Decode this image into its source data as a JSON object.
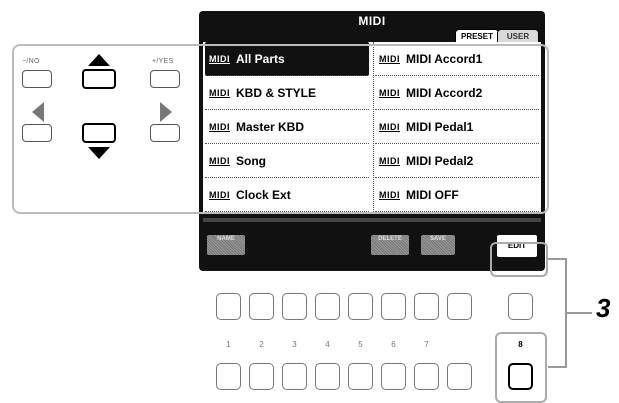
{
  "screen": {
    "title": "MIDI",
    "tabs": [
      "PRESET",
      "USER"
    ],
    "left_items": [
      "All Parts",
      "KBD & STYLE",
      "Master KBD",
      "Song",
      "Clock Ext"
    ],
    "right_items": [
      "MIDI Accord1",
      "MIDI Accord2",
      "MIDI Pedal1",
      "MIDI Pedal2",
      "MIDI OFF"
    ],
    "selected_item": "All Parts",
    "item_badge": "MIDI",
    "soft_buttons": {
      "name": "NAME",
      "delete": "DELETE",
      "save": "SAVE",
      "edit": "EDIT"
    }
  },
  "cursor_panel": {
    "no_label": "−/NO",
    "yes_label": "+/YES"
  },
  "panel_buttons": {
    "numbers": [
      "1",
      "2",
      "3",
      "4",
      "5",
      "6",
      "7",
      "8"
    ],
    "highlighted": "8"
  },
  "callout": {
    "step_number": "3"
  },
  "colors": {
    "screen_bg": "#111111",
    "highlight_frame": "#bbbbbb"
  }
}
